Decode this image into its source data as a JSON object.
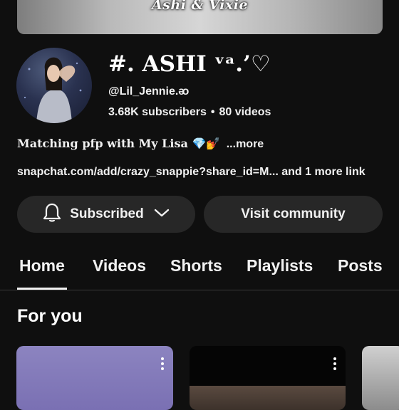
{
  "banner": {
    "text": "Ashi & Vixie"
  },
  "channel": {
    "name": "#. ASHI ᵛᵃ.’♡",
    "handle": "@Lil_Jennie.ᴔ",
    "subscribers": "3.68K subscribers",
    "separator": "•",
    "videos": "80 videos",
    "description": "Matching pfp with My Lisa 💎💅",
    "more_label": "...more",
    "link_line": "snapchat.com/add/crazy_snappie?share_id=M... and 1 more link"
  },
  "buttons": {
    "subscribed_label": "Subscribed",
    "visit_community_label": "Visit community"
  },
  "tabs": [
    {
      "label": "Home",
      "selected": true
    },
    {
      "label": "Videos",
      "selected": false
    },
    {
      "label": "Shorts",
      "selected": false
    },
    {
      "label": "Playlists",
      "selected": false
    },
    {
      "label": "Posts",
      "selected": false
    }
  ],
  "section": {
    "title": "For you"
  },
  "icons": {
    "bell": "bell-icon",
    "chevron": "chevron-down-icon",
    "more": "more-vertical-icon"
  },
  "colors": {
    "background": "#0f0f0f",
    "button_bg": "#272727",
    "text": "#f1f1f1"
  }
}
